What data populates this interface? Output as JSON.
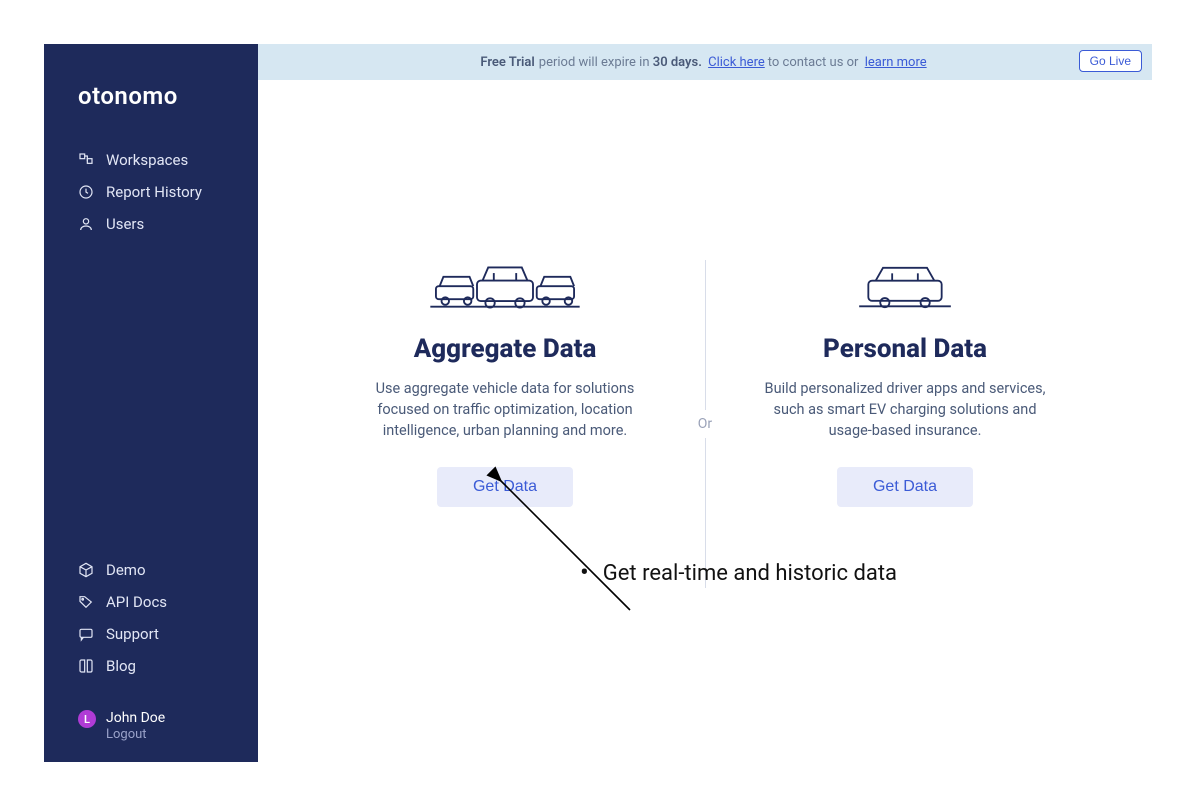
{
  "brand": "otonomo",
  "sidebar": {
    "primary": [
      {
        "label": "Workspaces"
      },
      {
        "label": "Report History"
      },
      {
        "label": "Users"
      }
    ],
    "secondary": [
      {
        "label": "Demo"
      },
      {
        "label": "API Docs"
      },
      {
        "label": "Support"
      },
      {
        "label": "Blog"
      }
    ]
  },
  "user": {
    "initial": "L",
    "name": "John Doe",
    "logout": "Logout"
  },
  "banner": {
    "bold": "Free Trial",
    "mid1": "period will expire in",
    "days": "30 days.",
    "link1": "Click here",
    "mid2": "to contact us or",
    "link2": "learn more",
    "golive": "Go Live"
  },
  "cards": {
    "left": {
      "title": "Aggregate Data",
      "desc": "Use aggregate vehicle data for solutions focused on traffic optimization, location intelligence, urban planning and more.",
      "button": "Get Data"
    },
    "or": "Or",
    "right": {
      "title": "Personal Data",
      "desc": "Build personalized driver apps and services, such as smart EV charging solutions and usage-based insurance.",
      "button": "Get Data"
    }
  },
  "annotation": {
    "text": "Get real-time and historic data"
  }
}
